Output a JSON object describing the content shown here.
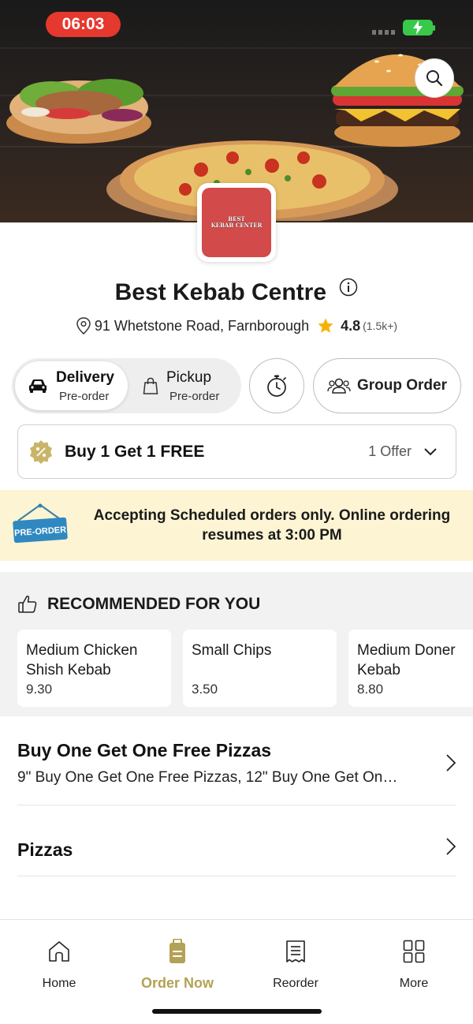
{
  "status_bar": {
    "time": "06:03"
  },
  "restaurant": {
    "name": "Best Kebab Centre",
    "logo_line1": "BEST",
    "logo_line2": "KEBAB CENTER",
    "address": "91 Whetstone Road, Farnborough",
    "rating": "4.8",
    "rating_count": "(1.5k+)"
  },
  "order_mode": {
    "delivery_label": "Delivery",
    "delivery_sub": "Pre-order",
    "pickup_label": "Pickup",
    "pickup_sub": "Pre-order",
    "selected": "delivery"
  },
  "group_order_label": "Group Order",
  "offer": {
    "label": "Buy 1 Get 1 FREE",
    "count": "1 Offer"
  },
  "banner": {
    "sign_text": "PRE-ORDER",
    "message": "Accepting Scheduled orders only. Online ordering resumes at 3:00 PM"
  },
  "recommended": {
    "title": "RECOMMENDED FOR YOU",
    "items": [
      {
        "name": "Medium Chicken Shish Kebab",
        "price": "9.30"
      },
      {
        "name": "Small Chips",
        "price": "3.50"
      },
      {
        "name": "Medium Doner Kebab",
        "price": "8.80"
      }
    ]
  },
  "categories": [
    {
      "name": "Buy One Get One Free Pizzas",
      "description": "9\" Buy One Get One Free Pizzas, 12\" Buy One Get On…"
    },
    {
      "name": "Pizzas",
      "description": ""
    }
  ],
  "tabs": [
    {
      "label": "Home",
      "icon": "home-icon"
    },
    {
      "label": "Order Now",
      "icon": "order-bag-icon"
    },
    {
      "label": "Reorder",
      "icon": "receipt-icon"
    },
    {
      "label": "More",
      "icon": "grid-icon"
    }
  ],
  "colors": {
    "accent": "#b3a255",
    "banner_bg": "#fdf4d3",
    "time_pill": "#e5382e",
    "star": "#f5b301",
    "logo_bg": "#d24a4a"
  }
}
